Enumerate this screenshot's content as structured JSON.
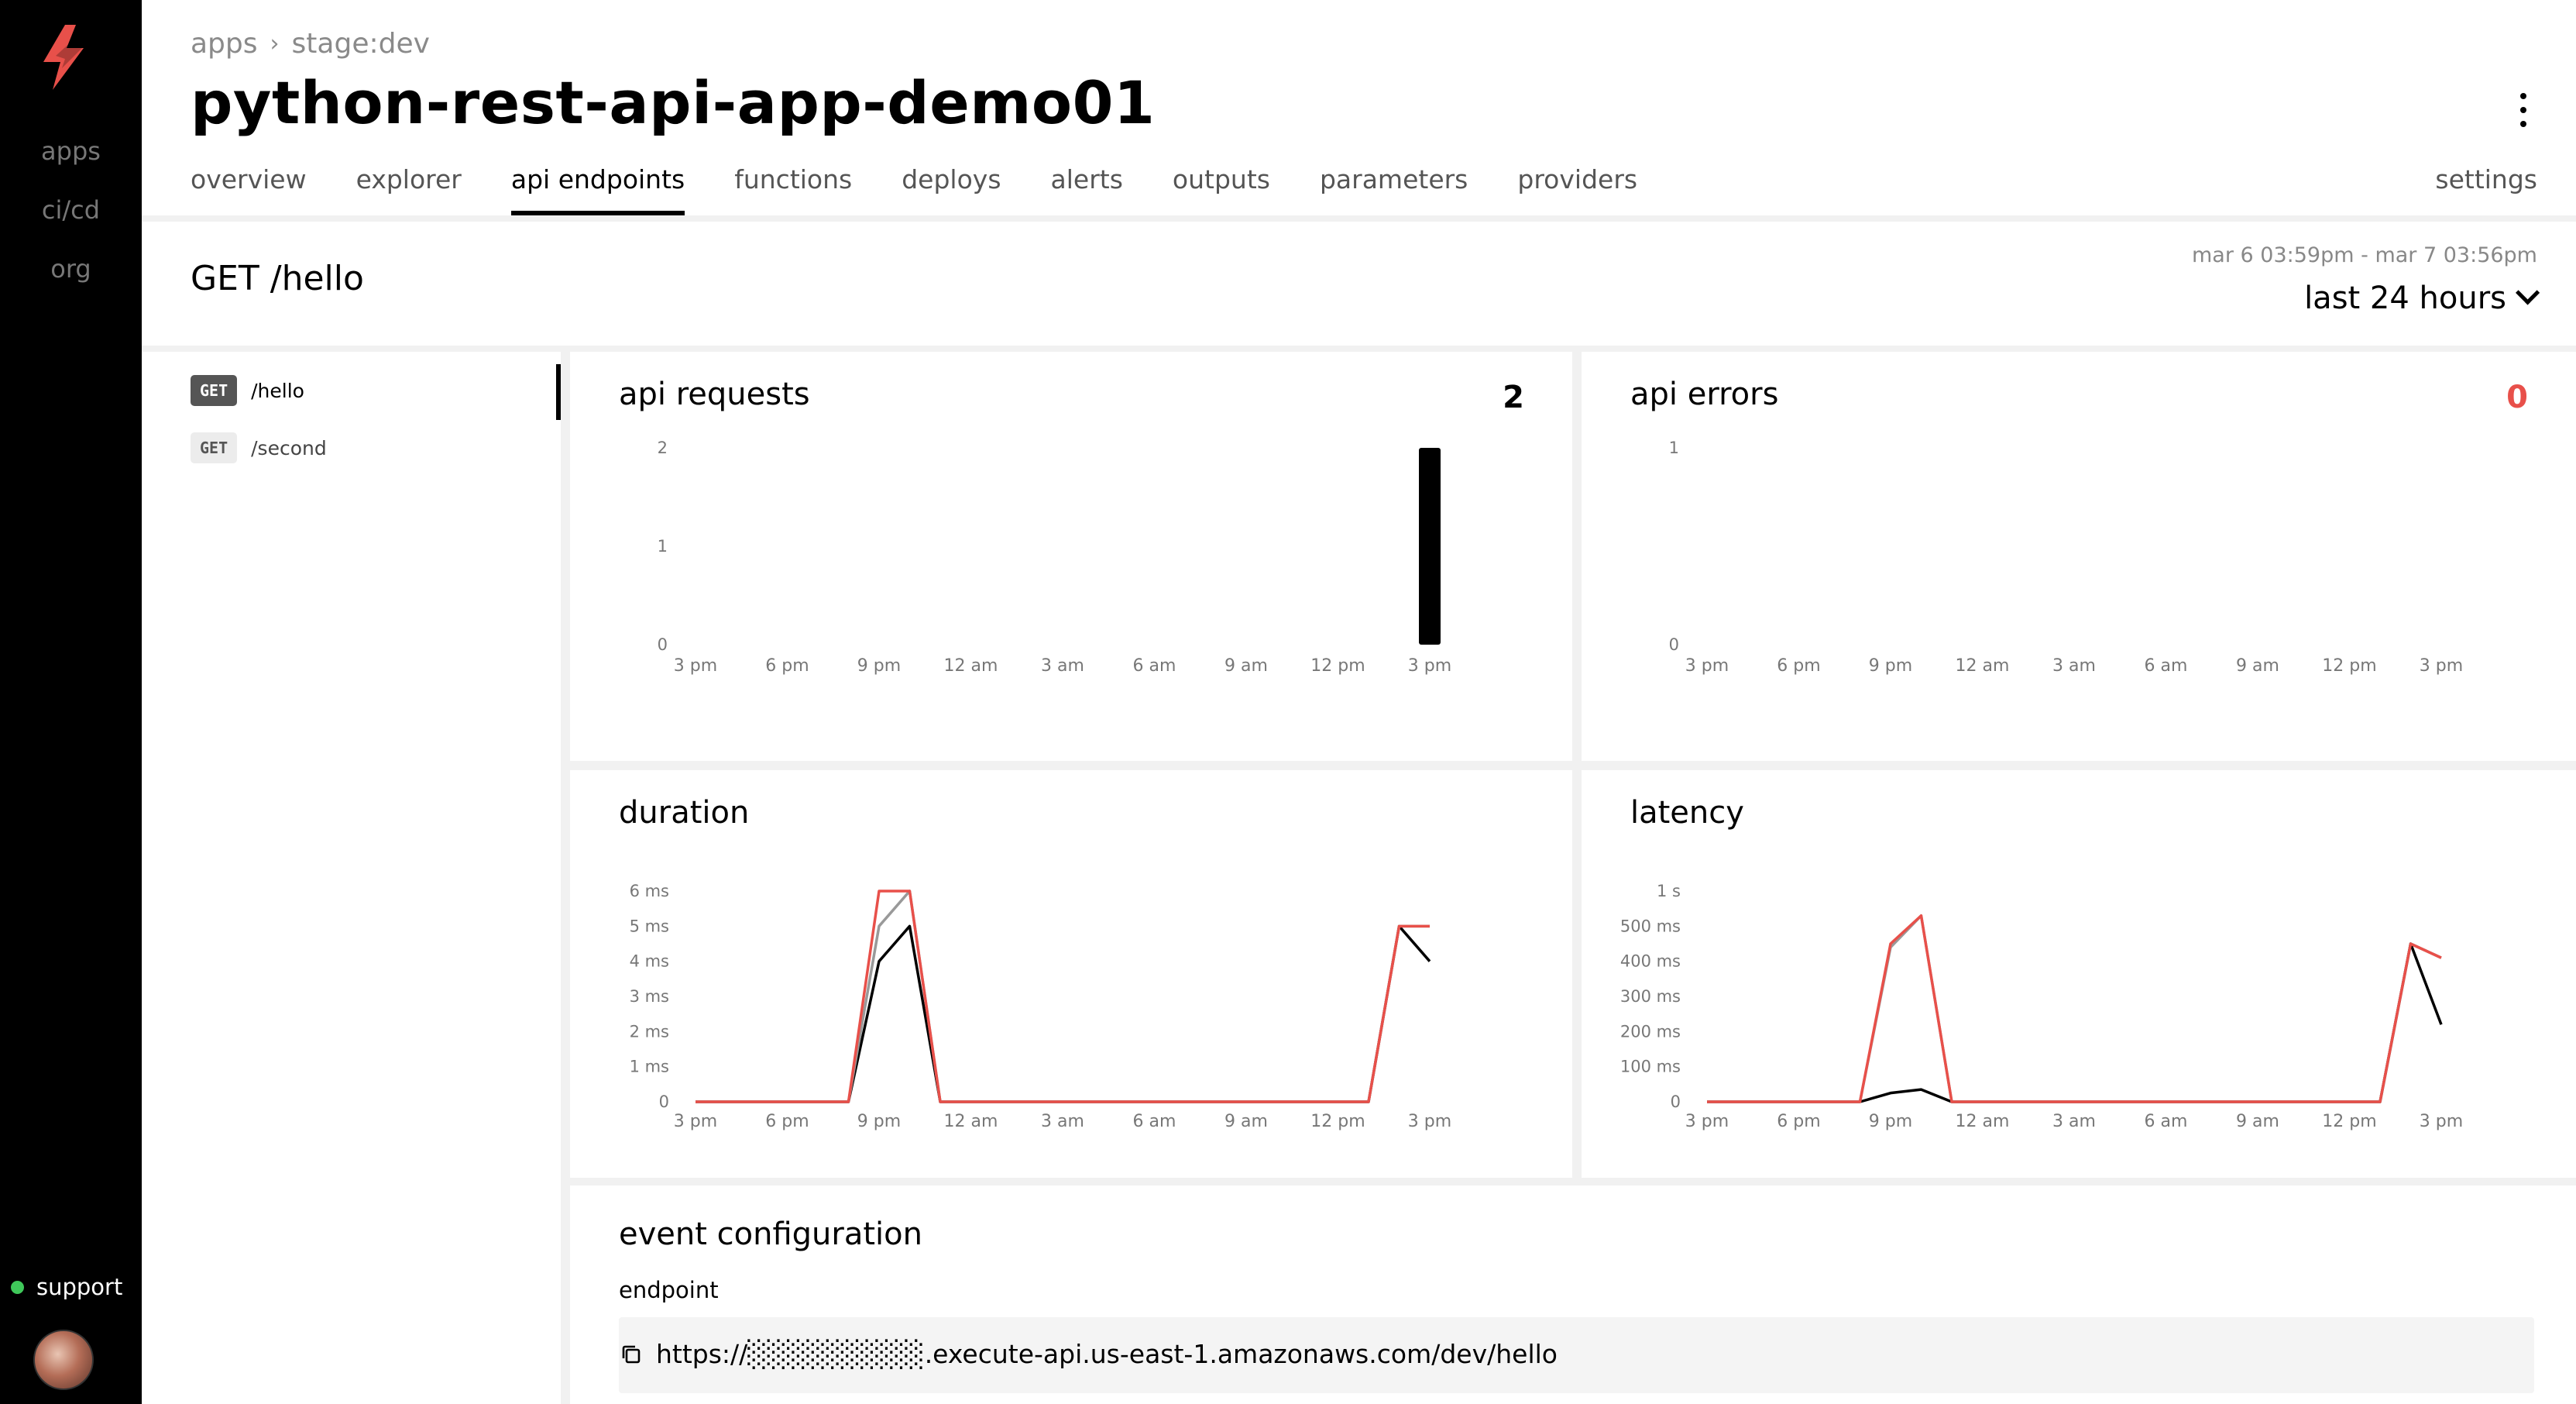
{
  "rail": {
    "nav": [
      {
        "label": "apps",
        "active": true
      },
      {
        "label": "ci/cd",
        "active": false
      },
      {
        "label": "org",
        "active": false
      }
    ],
    "support_label": "support",
    "support_status_color": "#3fc85a"
  },
  "header": {
    "breadcrumb": [
      "apps",
      "stage:dev"
    ],
    "title": "python-rest-api-app-demo01",
    "tabs": [
      "overview",
      "explorer",
      "api endpoints",
      "functions",
      "deploys",
      "alerts",
      "outputs",
      "parameters",
      "providers"
    ],
    "active_tab": "api endpoints",
    "settings_label": "settings"
  },
  "endpoint": {
    "title": "GET /hello",
    "range_caption": "mar 6 03:59pm - mar 7 03:56pm",
    "range_label": "last 24 hours"
  },
  "routes": [
    {
      "method": "GET",
      "path": "/hello",
      "active": true
    },
    {
      "method": "GET",
      "path": "/second",
      "active": false
    }
  ],
  "cards": {
    "api_requests": {
      "title": "api requests",
      "value": "2"
    },
    "api_errors": {
      "title": "api errors",
      "value": "0"
    },
    "duration": {
      "title": "duration"
    },
    "latency": {
      "title": "latency"
    }
  },
  "event_config": {
    "title": "event configuration",
    "endpoint_label": "endpoint",
    "url": "https://░░░░░░░░░.execute-api.us-east-1.amazonaws.com/dev/hello"
  },
  "colors": {
    "accent": "#e8504a",
    "error_value": "#e8504a",
    "series_gray": "#999999"
  },
  "chart_data": [
    {
      "id": "api_requests",
      "type": "bar",
      "x_ticks": [
        "3 pm",
        "6 pm",
        "9 pm",
        "12 am",
        "3 am",
        "6 am",
        "9 am",
        "12 pm",
        "3 pm"
      ],
      "y_ticks": [
        "0",
        "1",
        "2"
      ],
      "ylim": [
        0,
        2
      ],
      "bars": [
        {
          "x": 24,
          "value": 2
        }
      ]
    },
    {
      "id": "api_errors",
      "type": "bar",
      "x_ticks": [
        "3 pm",
        "6 pm",
        "9 pm",
        "12 am",
        "3 am",
        "6 am",
        "9 am",
        "12 pm",
        "3 pm"
      ],
      "y_ticks": [
        "0",
        "1"
      ],
      "ylim": [
        0,
        1
      ],
      "bars": []
    },
    {
      "id": "duration",
      "type": "line",
      "x_ticks": [
        "3 pm",
        "6 pm",
        "9 pm",
        "12 am",
        "3 am",
        "6 am",
        "9 am",
        "12 pm",
        "3 pm"
      ],
      "y_ticks": [
        "0",
        "1 ms",
        "2 ms",
        "3 ms",
        "4 ms",
        "5 ms",
        "6 ms"
      ],
      "ylim": [
        0,
        6
      ],
      "series": [
        {
          "color": "#000000",
          "points": [
            [
              0,
              0
            ],
            [
              5,
              0
            ],
            [
              6,
              4
            ],
            [
              7,
              5
            ],
            [
              8,
              0
            ],
            [
              22,
              0
            ],
            [
              23,
              5
            ],
            [
              24,
              4
            ]
          ]
        },
        {
          "color": "#999999",
          "points": [
            [
              0,
              0
            ],
            [
              5,
              0
            ],
            [
              6,
              5
            ],
            [
              7,
              6
            ],
            [
              8,
              0
            ],
            [
              22,
              0
            ],
            [
              23,
              5
            ],
            [
              24,
              5
            ]
          ]
        },
        {
          "color": "#e8504a",
          "points": [
            [
              0,
              0
            ],
            [
              5,
              0
            ],
            [
              6,
              6
            ],
            [
              7,
              6
            ],
            [
              8,
              0
            ],
            [
              22,
              0
            ],
            [
              23,
              5
            ],
            [
              24,
              5
            ]
          ]
        }
      ]
    },
    {
      "id": "latency",
      "type": "line",
      "x_ticks": [
        "3 pm",
        "6 pm",
        "9 pm",
        "12 am",
        "3 am",
        "6 am",
        "9 am",
        "12 pm",
        "3 pm"
      ],
      "y_ticks": [
        "0",
        "100 ms",
        "200 ms",
        "300 ms",
        "400 ms",
        "500 ms",
        "1 s"
      ],
      "ylim": [
        0,
        6
      ],
      "series": [
        {
          "color": "#000000",
          "points": [
            [
              0,
              0
            ],
            [
              5,
              0
            ],
            [
              6,
              0.25
            ],
            [
              7,
              0.35
            ],
            [
              8,
              0
            ],
            [
              22,
              0
            ],
            [
              23,
              4.5
            ],
            [
              24,
              2.2
            ]
          ]
        },
        {
          "color": "#999999",
          "points": [
            [
              0,
              0
            ],
            [
              5,
              0
            ],
            [
              6,
              4.4
            ],
            [
              7,
              5.3
            ],
            [
              8,
              0
            ],
            [
              22,
              0
            ],
            [
              23,
              4.5
            ],
            [
              24,
              4.1
            ]
          ]
        },
        {
          "color": "#e8504a",
          "points": [
            [
              0,
              0
            ],
            [
              5,
              0
            ],
            [
              6,
              4.5
            ],
            [
              7,
              5.3
            ],
            [
              8,
              0
            ],
            [
              22,
              0
            ],
            [
              23,
              4.5
            ],
            [
              24,
              4.1
            ]
          ]
        }
      ]
    }
  ]
}
